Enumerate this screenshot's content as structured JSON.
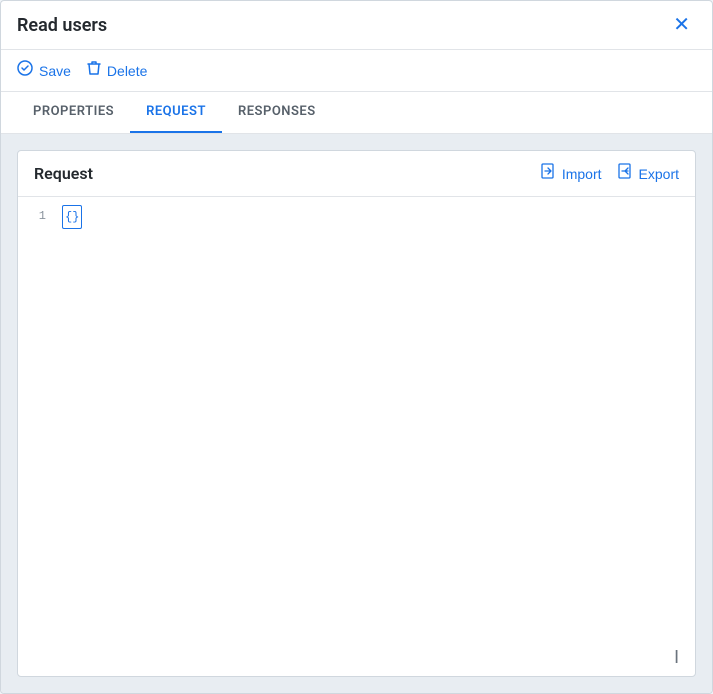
{
  "modal": {
    "title": "Read users"
  },
  "toolbar": {
    "save_label": "Save",
    "delete_label": "Delete"
  },
  "tabs": [
    {
      "id": "properties",
      "label": "PROPERTIES",
      "active": false
    },
    {
      "id": "request",
      "label": "REQUEST",
      "active": true
    },
    {
      "id": "responses",
      "label": "RESPONSES",
      "active": false
    }
  ],
  "request_card": {
    "title": "Request",
    "import_label": "Import",
    "export_label": "Export"
  },
  "code": {
    "line1": "{}"
  },
  "icons": {
    "close": "✕",
    "save": "⏻",
    "delete": "🗑",
    "import": "⬆",
    "export": "⬇",
    "cursor": "I"
  }
}
